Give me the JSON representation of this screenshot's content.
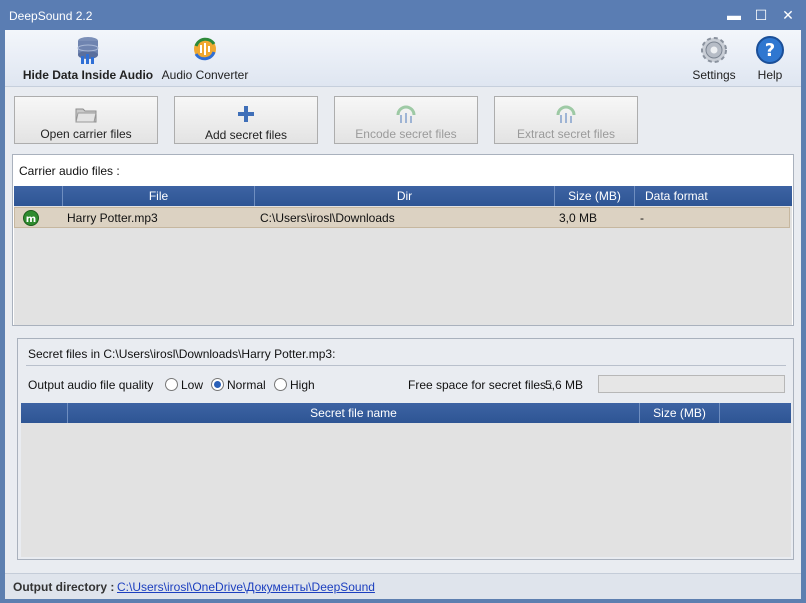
{
  "window": {
    "title": "DeepSound 2.2",
    "minimize": "▬",
    "maximize": "☐",
    "close": "✕"
  },
  "toolbar": {
    "hide_data": "Hide Data Inside Audio",
    "audio_converter": "Audio Converter",
    "settings": "Settings",
    "help": "Help"
  },
  "actions": {
    "open_carrier": "Open carrier files",
    "add_secret": "Add secret files",
    "encode_secret": "Encode secret files",
    "extract_secret": "Extract secret files"
  },
  "carrier": {
    "section_label": "Carrier audio files :",
    "columns": [
      "File",
      "Dir",
      "Size (MB)",
      "Data format"
    ],
    "rows": [
      {
        "icon": "m",
        "file": "Harry Potter.mp3",
        "dir": "C:\\Users\\irosl\\Downloads",
        "size": "3,0 MB",
        "format": "-"
      }
    ]
  },
  "secret": {
    "section_label": "Secret files in C:\\Users\\irosl\\Downloads\\Harry Potter.mp3:",
    "quality_label": "Output audio file quality",
    "quality_options": [
      "Low",
      "Normal",
      "High"
    ],
    "quality_selected": "Normal",
    "free_space_label": "Free space for secret files :",
    "free_space_value": "5,6 MB",
    "free_space_used_fraction": 0,
    "columns": [
      "Secret file name",
      "Size (MB)"
    ]
  },
  "status": {
    "output_label": "Output directory :",
    "output_path": "C:\\Users\\irosl\\OneDrive\\Документы\\DeepSound"
  }
}
